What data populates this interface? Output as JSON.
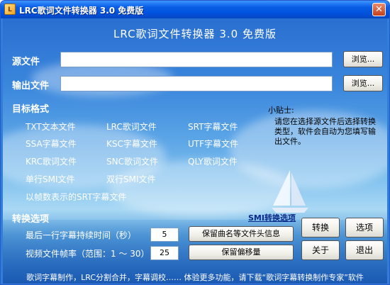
{
  "window": {
    "title": "LRC歌词文件转换器 3.0 免费版",
    "close_glyph": "✕",
    "icon_glyph": "L"
  },
  "header": {
    "title": "LRC歌词文件转换器 3.0 免费版"
  },
  "source": {
    "label": "源文件",
    "value": "",
    "browse_label": "浏览..."
  },
  "output": {
    "label": "输出文件",
    "value": "",
    "browse_label": "浏览..."
  },
  "formats": {
    "label": "目标格式",
    "items": [
      "TXT文本文件",
      "LRC歌词文件",
      "SRT字幕文件",
      "SSA字幕文件",
      "KSC字幕文件",
      "UTF字幕文件",
      "KRC歌词文件",
      "SNC歌词文件",
      "QLY歌词文件",
      "单行SMI文件",
      "双行SMI文件",
      "以帧数表示的SRT字幕文件"
    ]
  },
  "tip": {
    "title": "小贴士:",
    "text": "请您在选择源文件后选择转换类型，软件会自动为您填写输出文件。"
  },
  "options": {
    "label": "转换选项",
    "smi_link": "SMI转换选项",
    "last_line_label": "最后一行字幕持续时间（秒）",
    "last_line_value": "5",
    "fps_label": "视频文件帧率（范围：1 ～ 30）",
    "fps_value": "25",
    "keep_header_label": "保留曲名等文件头信息",
    "keep_offset_label": "保留偏移量"
  },
  "actions": {
    "convert": "转换",
    "options": "选项",
    "about": "关于",
    "exit": "退出"
  },
  "footer": "歌词字幕制作，LRC分割合并，字幕调校…… 体验更多功能，请下载“歌词字幕转换制作专家”软件",
  "colors": {
    "titlebar": "#0a5fe6",
    "client_top": "#2a6fd0",
    "link": "#0b2a8a"
  }
}
